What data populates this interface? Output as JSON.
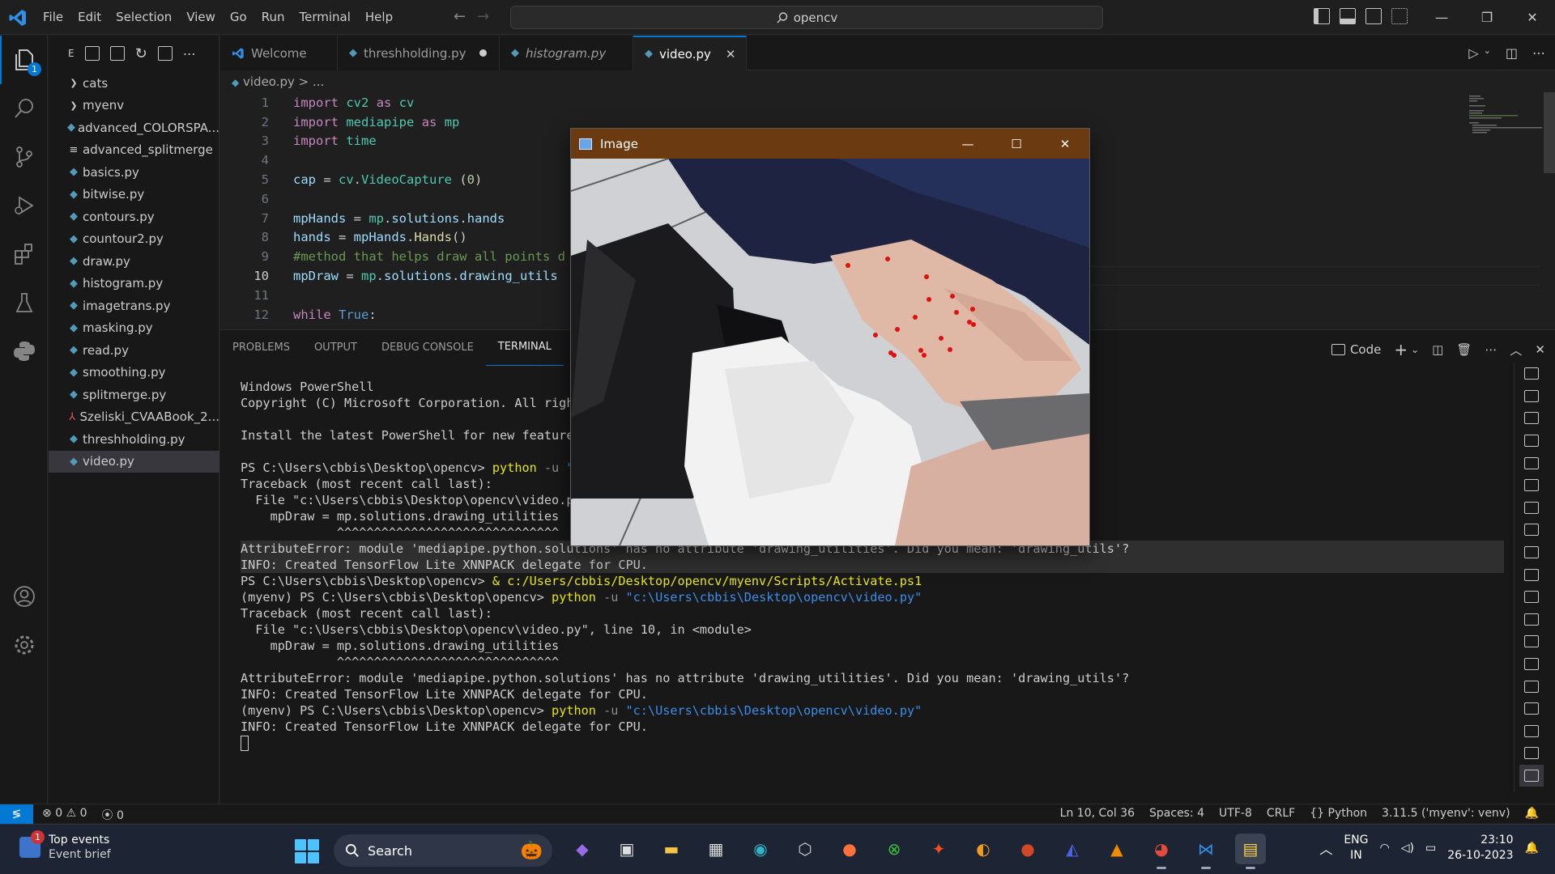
{
  "titlebar": {
    "menus": [
      "File",
      "Edit",
      "Selection",
      "View",
      "Go",
      "Run",
      "Terminal",
      "Help"
    ],
    "search": "opencv",
    "window_controls": [
      "—",
      "❐",
      "✕"
    ]
  },
  "activity_badge": "1",
  "sidebar": {
    "header": "E",
    "files": [
      {
        "name": "cats",
        "type": "folder"
      },
      {
        "name": "myenv",
        "type": "folder"
      },
      {
        "name": "advanced_COLORSPA...",
        "type": "py"
      },
      {
        "name": "advanced_splitmerge",
        "type": "txt"
      },
      {
        "name": "basics.py",
        "type": "py"
      },
      {
        "name": "bitwise.py",
        "type": "py"
      },
      {
        "name": "contours.py",
        "type": "py"
      },
      {
        "name": "countour2.py",
        "type": "py"
      },
      {
        "name": "draw.py",
        "type": "py"
      },
      {
        "name": "histogram.py",
        "type": "py"
      },
      {
        "name": "imagetrans.py",
        "type": "py"
      },
      {
        "name": "masking.py",
        "type": "py"
      },
      {
        "name": "read.py",
        "type": "py"
      },
      {
        "name": "smoothing.py",
        "type": "py"
      },
      {
        "name": "splitmerge.py",
        "type": "py"
      },
      {
        "name": "Szeliski_CVAABook_2...",
        "type": "pdf"
      },
      {
        "name": "threshholding.py",
        "type": "py"
      },
      {
        "name": "video.py",
        "type": "py",
        "selected": true
      }
    ]
  },
  "tabs": [
    {
      "label": "Welcome"
    },
    {
      "label": "threshholding.py",
      "modified": true
    },
    {
      "label": "histogram.py",
      "italic": true
    },
    {
      "label": "video.py",
      "active": true
    }
  ],
  "editor": {
    "breadcrumb": "video.py  >  ...",
    "current_line": 10,
    "line_numbers": [
      "1",
      "2",
      "3",
      "4",
      "5",
      "6",
      "7",
      "8",
      "9",
      "10",
      "11",
      "12"
    ]
  },
  "panel": {
    "tabs": [
      "PROBLEMS",
      "OUTPUT",
      "DEBUG CONSOLE",
      "TERMINAL"
    ],
    "active_tab": "TERMINAL",
    "terminal_profile": "Code",
    "terminal_lines": [
      {
        "text": "Windows PowerShell"
      },
      {
        "text": "Copyright (C) Microsoft Corporation. All righ"
      },
      {
        "text": ""
      },
      {
        "text": "Install the latest PowerShell for new feature"
      },
      {
        "text": ""
      },
      {
        "prompt": "PS C:\\Users\\cbbis\\Desktop\\opencv> ",
        "cmd": "python",
        "flag": " -u ",
        "arg": "\""
      },
      {
        "text": "Traceback (most recent call last):"
      },
      {
        "text": "  File \"c:\\Users\\cbbis\\Desktop\\opencv\\video.p"
      },
      {
        "text": "    mpDraw = mp.solutions.drawing_utilities"
      },
      {
        "text": "             ^^^^^^^^^^^^^^^^^^^^^^^^^^^^^^"
      },
      {
        "text": "AttributeError: module 'mediapipe.python.solutions' has no attribute 'drawing_utilities'. Did you mean: 'drawing_utils'?",
        "hl": true
      },
      {
        "text": "INFO: Created TensorFlow Lite XNNPACK delegate for CPU.",
        "hl": true
      },
      {
        "prompt": "PS C:\\Users\\cbbis\\Desktop\\opencv> ",
        "cmd": "& c:/Users/cbbis/Desktop/opencv/myenv/Scripts/Activate.ps1",
        "flag": "",
        "arg": ""
      },
      {
        "prompt": "(myenv) PS C:\\Users\\cbbis\\Desktop\\opencv> ",
        "cmd": "python",
        "flag": " -u ",
        "arg": "\"c:\\Users\\cbbis\\Desktop\\opencv\\video.py\""
      },
      {
        "text": "Traceback (most recent call last):"
      },
      {
        "text": "  File \"c:\\Users\\cbbis\\Desktop\\opencv\\video.py\", line 10, in <module>"
      },
      {
        "text": "    mpDraw = mp.solutions.drawing_utilities"
      },
      {
        "text": "             ^^^^^^^^^^^^^^^^^^^^^^^^^^^^^^"
      },
      {
        "text": "AttributeError: module 'mediapipe.python.solutions' has no attribute 'drawing_utilities'. Did you mean: 'drawing_utils'?"
      },
      {
        "text": "INFO: Created TensorFlow Lite XNNPACK delegate for CPU."
      },
      {
        "prompt": "(myenv) PS C:\\Users\\cbbis\\Desktop\\opencv> ",
        "cmd": "python",
        "flag": " -u ",
        "arg": "\"c:\\Users\\cbbis\\Desktop\\opencv\\video.py\""
      },
      {
        "text": "INFO: Created TensorFlow Lite XNNPACK delegate for CPU."
      }
    ]
  },
  "statusbar": {
    "errors": "0",
    "warnings": "0",
    "ports": "0",
    "position": "Ln 10, Col 36",
    "spaces": "Spaces: 4",
    "encoding": "UTF-8",
    "eol": "CRLF",
    "language": "Python",
    "interpreter": "3.11.5 ('myenv': venv)"
  },
  "cv_window": {
    "title": "Image",
    "controls": [
      "—",
      "☐",
      "✕"
    ]
  },
  "taskbar": {
    "widget_badge": "1",
    "widget_title": "Top events",
    "widget_subtitle": "Event brief",
    "search": "Search",
    "lang_top": "ENG",
    "lang_bottom": "IN",
    "time": "23:10",
    "date": "26-10-2023"
  }
}
